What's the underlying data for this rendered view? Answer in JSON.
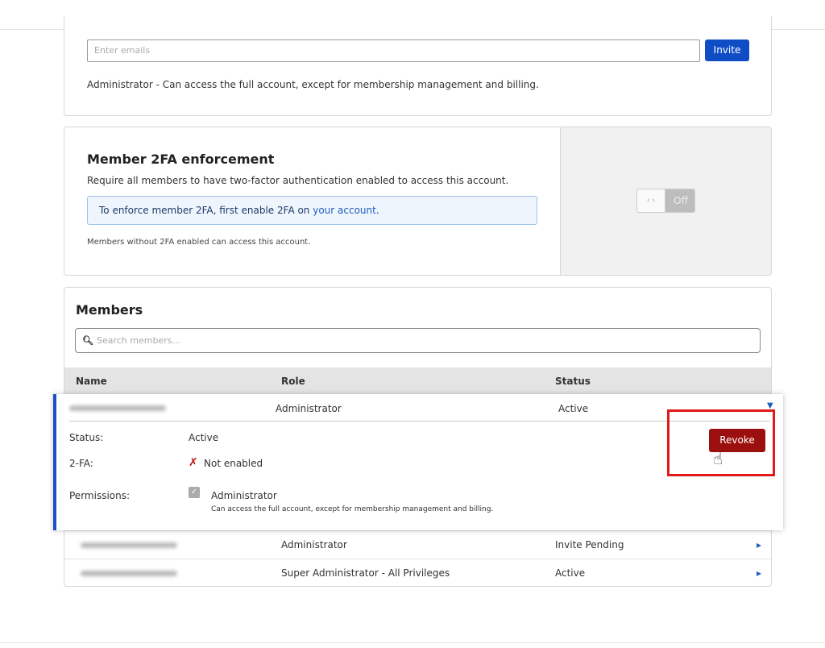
{
  "invite": {
    "email_placeholder": "Enter emails",
    "invite_label": "Invite",
    "role_description": "Administrator - Can access the full account, except for membership management and billing."
  },
  "twofa": {
    "title": "Member 2FA enforcement",
    "description": "Require all members to have two-factor authentication enabled to access this account.",
    "info_prefix": "To enforce member 2FA, first enable 2FA on ",
    "info_link": "your account",
    "info_suffix": ".",
    "note": "Members without 2FA enabled can access this account.",
    "toggle_knob": "‹ ›",
    "toggle_state": "Off"
  },
  "members": {
    "title": "Members",
    "search_placeholder": "Search members...",
    "columns": [
      "Name",
      "Role",
      "Status"
    ],
    "expanded": {
      "role": "Administrator",
      "status": "Active",
      "status_label": "Status:",
      "status_value": "Active",
      "twofa_label": "2-FA:",
      "twofa_value": "Not enabled",
      "permissions_label": "Permissions:",
      "permission_name": "Administrator",
      "permission_desc": "Can access the full account, except for membership management and billing.",
      "revoke_label": "Revoke"
    },
    "rows": [
      {
        "role": "Administrator",
        "status": "Invite Pending"
      },
      {
        "role": "Super Administrator - All Privileges",
        "status": "Active"
      }
    ]
  },
  "colors": {
    "primary": "#0f4dc7",
    "danger": "#9c0f0f",
    "highlight": "#e21a1a"
  }
}
